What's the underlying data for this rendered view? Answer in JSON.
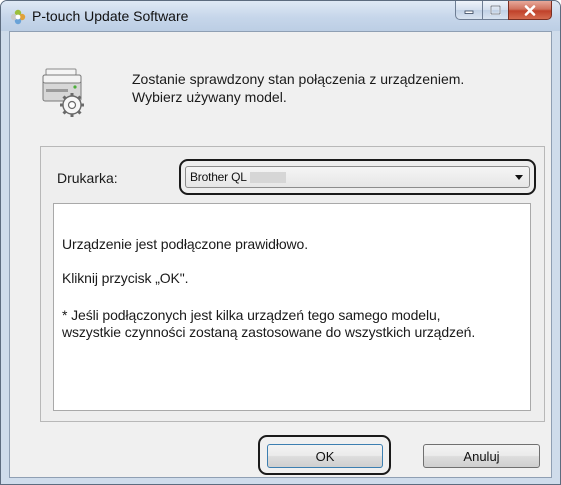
{
  "window": {
    "title": "P-touch Update Software",
    "app_icon": "ptouch-flower-icon"
  },
  "caption_buttons": {
    "minimize_icon": "minimize-icon",
    "maximize_icon": "maximize-icon",
    "close_icon": "close-icon"
  },
  "header": {
    "icon": "printer-gear-icon",
    "line1": "Zostanie sprawdzony stan połączenia z urządzeniem.",
    "line2": "Wybierz używany model."
  },
  "printer": {
    "label": "Drukarka:",
    "selected": "Brother QL",
    "dropdown_icon": "chevron-down-icon"
  },
  "message": {
    "line1": "Urządzenie jest podłączone prawidłowo.",
    "line2": "Kliknij przycisk „OK\".",
    "line3": "* Jeśli podłączonych jest kilka urządzeń tego samego modelu, wszystkie czynności zostaną zastosowane do wszystkich urządzeń."
  },
  "buttons": {
    "ok": "OK",
    "cancel": "Anuluj"
  },
  "colors": {
    "titlebar": "#c6d6ea",
    "dialog_bg": "#f0f0f0",
    "close_button": "#c0412a",
    "highlight_frame": "#1a1a1a"
  }
}
